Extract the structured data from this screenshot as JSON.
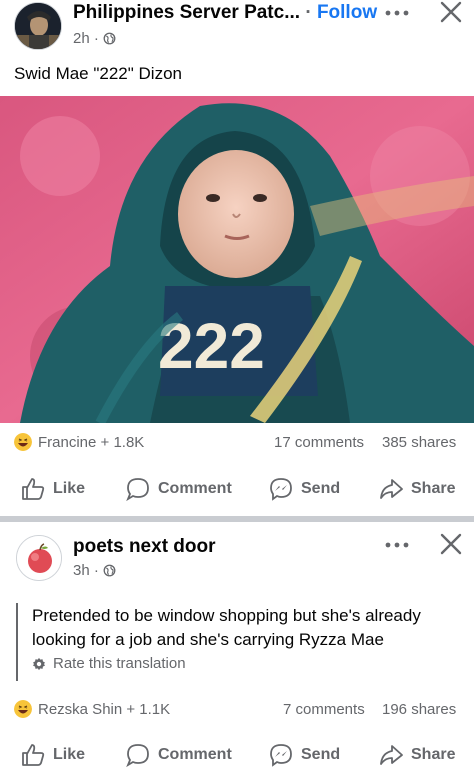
{
  "post1": {
    "page_name": "Philippines Server Patc...",
    "separator": "·",
    "follow_label": "Follow",
    "time": "2h ·",
    "caption": "Swid Mae \"222\" Dizon",
    "photo_number": "222",
    "reactions_text": "Francine + 1.8K",
    "comments": "17 comments",
    "shares": "385 shares"
  },
  "post2": {
    "page_name": "poets next door",
    "time": "3h ·",
    "text_line1": "Pretended to be window shopping but she's already",
    "text_line2": "looking for a job and she's carrying Ryzza Mae",
    "rate_label": "Rate this translation",
    "reactions_text": "Rezska Shin + 1.1K",
    "comments": "7 comments",
    "shares": "196 shares"
  },
  "actions": {
    "like": "Like",
    "comment": "Comment",
    "send": "Send",
    "share": "Share"
  },
  "icons": {
    "more": "more-dots-icon",
    "close": "close-icon",
    "globe": "globe-icon",
    "like": "thumbs-up-icon",
    "comment": "comment-bubble-icon",
    "send": "messenger-icon",
    "share": "share-arrow-icon",
    "reaction": "laughing-emoji-icon",
    "settings": "gear-icon"
  },
  "colors": {
    "follow": "#1877f2",
    "secondary_text": "#65676b",
    "divider": "#c9ccd1",
    "reaction_yellow": "#f7c43a"
  }
}
